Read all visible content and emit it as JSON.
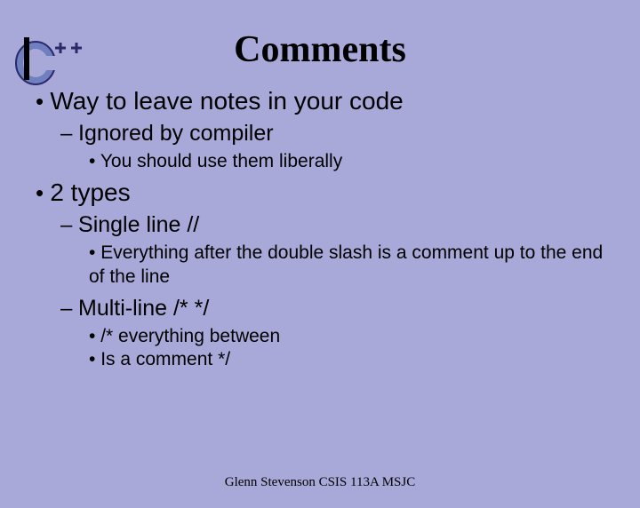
{
  "title": "Comments",
  "bullets": {
    "b1": "Way to leave notes in your code",
    "b1_1": "Ignored by compiler",
    "b1_1_1": "You should use them liberally",
    "b2": "2 types",
    "b2_1": "Single line //",
    "b2_1_1": " Everything after the double slash is a comment up to the end of the line",
    "b2_2": "Multi-line /* */",
    "b2_2_1": "/* everything between",
    "b2_2_2": "Is a comment */"
  },
  "footer": "Glenn Stevenson CSIS 113A MSJC"
}
